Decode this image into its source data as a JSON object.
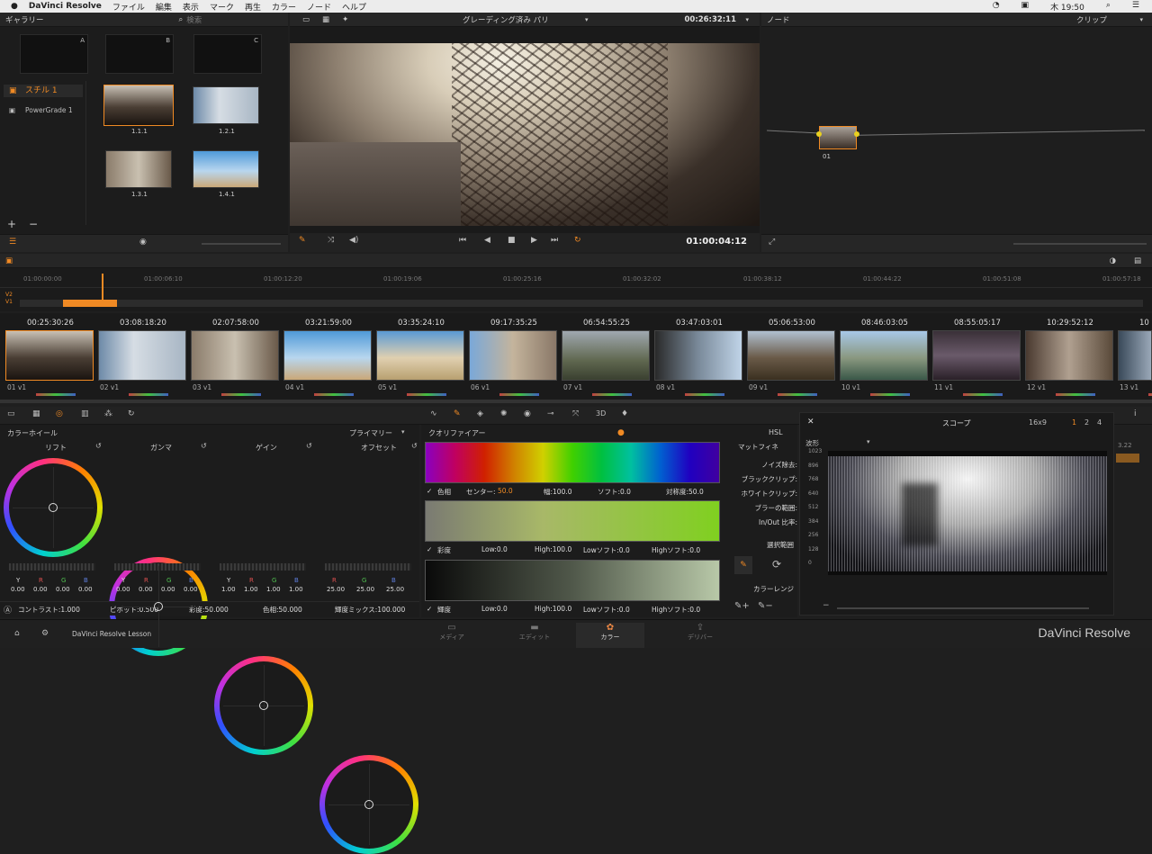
{
  "menubar": {
    "apple": "",
    "app": "DaVinci Resolve",
    "items": [
      "ファイル",
      "編集",
      "表示",
      "マーク",
      "再生",
      "カラー",
      "ノード",
      "ヘルプ"
    ],
    "time": "木 19:50"
  },
  "gallery": {
    "title": "ギャラリー",
    "search": "検索",
    "slots": [
      "A",
      "B",
      "C"
    ],
    "albums": [
      "スチル 1",
      "PowerGrade 1"
    ],
    "stills": [
      "1.1.1",
      "1.2.1",
      "1.3.1",
      "1.4.1"
    ],
    "add": "+",
    "remove": "−"
  },
  "viewer": {
    "title": "グレーディング済み パリ",
    "timecode": "00:26:32:11",
    "playhead": "01:00:04:12"
  },
  "nodes": {
    "title": "ノード",
    "clip": "クリップ",
    "node_label": "01"
  },
  "timeline": {
    "ticks": [
      "01:00:00:00",
      "01:00:06:10",
      "01:00:12:20",
      "01:00:19:06",
      "01:00:25:16",
      "01:00:32:02",
      "01:00:38:12",
      "01:00:44:22",
      "01:00:51:08",
      "01:00:57:18"
    ],
    "tracks": [
      "V2",
      "V1"
    ]
  },
  "clips": [
    {
      "tc": "00:25:30:26",
      "num": "01",
      "track": "V1"
    },
    {
      "tc": "03:08:18:20",
      "num": "02",
      "track": "V1"
    },
    {
      "tc": "02:07:58:00",
      "num": "03",
      "track": "V1"
    },
    {
      "tc": "03:21:59:00",
      "num": "04",
      "track": "V1"
    },
    {
      "tc": "03:35:24:10",
      "num": "05",
      "track": "V1"
    },
    {
      "tc": "09:17:35:25",
      "num": "06",
      "track": "V1"
    },
    {
      "tc": "06:54:55:25",
      "num": "07",
      "track": "V1"
    },
    {
      "tc": "03:47:03:01",
      "num": "08",
      "track": "V1"
    },
    {
      "tc": "05:06:53:00",
      "num": "09",
      "track": "V1"
    },
    {
      "tc": "08:46:03:05",
      "num": "10",
      "track": "V1"
    },
    {
      "tc": "08:55:05:17",
      "num": "11",
      "track": "V1"
    },
    {
      "tc": "10:29:52:12",
      "num": "12",
      "track": "V1"
    },
    {
      "tc": "10",
      "num": "13",
      "track": "V1"
    }
  ],
  "colorwheels": {
    "title": "カラーホイール",
    "mode": "プライマリー",
    "wheels": [
      {
        "name": "リフト",
        "vals": [
          "0.00",
          "0.00",
          "0.00",
          "0.00"
        ]
      },
      {
        "name": "ガンマ",
        "vals": [
          "0.00",
          "0.00",
          "0.00",
          "0.00"
        ]
      },
      {
        "name": "ゲイン",
        "vals": [
          "1.00",
          "1.00",
          "1.00",
          "1.00"
        ]
      },
      {
        "name": "オフセット",
        "vals": [
          "25.00",
          "25.00",
          "25.00"
        ]
      }
    ],
    "channels": [
      "Y",
      "R",
      "G",
      "B"
    ],
    "footer": {
      "contrast": "コントラスト:1.000",
      "pivot": "ピボット:0.500",
      "sat": "彩度:50.000",
      "hue": "色相:50.000",
      "lummix": "輝度ミックス:100.000"
    }
  },
  "qualifier": {
    "title": "クオリファイアー",
    "mode": "HSL",
    "hue": {
      "label": "色相",
      "center": "センター:",
      "center_val": "50.0",
      "width": "幅:100.0",
      "soft": "ソフト:0.0",
      "sym": "対称度:50.0"
    },
    "sat": {
      "label": "彩度",
      "low": "Low:0.0",
      "high": "High:100.0",
      "lowsoft": "Lowソフト:0.0",
      "highsoft": "Highソフト:0.0"
    },
    "lum": {
      "label": "輝度",
      "low": "Low:0.0",
      "high": "High:100.0",
      "lowsoft": "Lowソフト:0.0",
      "highsoft": "Highソフト:0.0"
    },
    "side": [
      "マットフィネ",
      "ノイズ除去:",
      "ブラッククリップ:",
      "ホワイトクリップ:",
      "ブラーの範囲:",
      "In/Out 比率:",
      "選択範囲",
      "カラーレンジ"
    ]
  },
  "scope": {
    "title": "スコープ",
    "ratio": "16x9",
    "pages": [
      "1",
      "2",
      "4"
    ],
    "type": "波形",
    "ticks": [
      "1023",
      "896",
      "768",
      "640",
      "512",
      "384",
      "256",
      "128",
      "0"
    ],
    "extra": "3.22"
  },
  "bottom": {
    "project": "DaVinci Resolve Lesson",
    "tabs": [
      "メディア",
      "エディット",
      "カラー",
      "デリバー"
    ],
    "brand": "DaVinci Resolve"
  },
  "colors": {
    "accent": "#f08a24",
    "bg": "#1f1f1f"
  }
}
